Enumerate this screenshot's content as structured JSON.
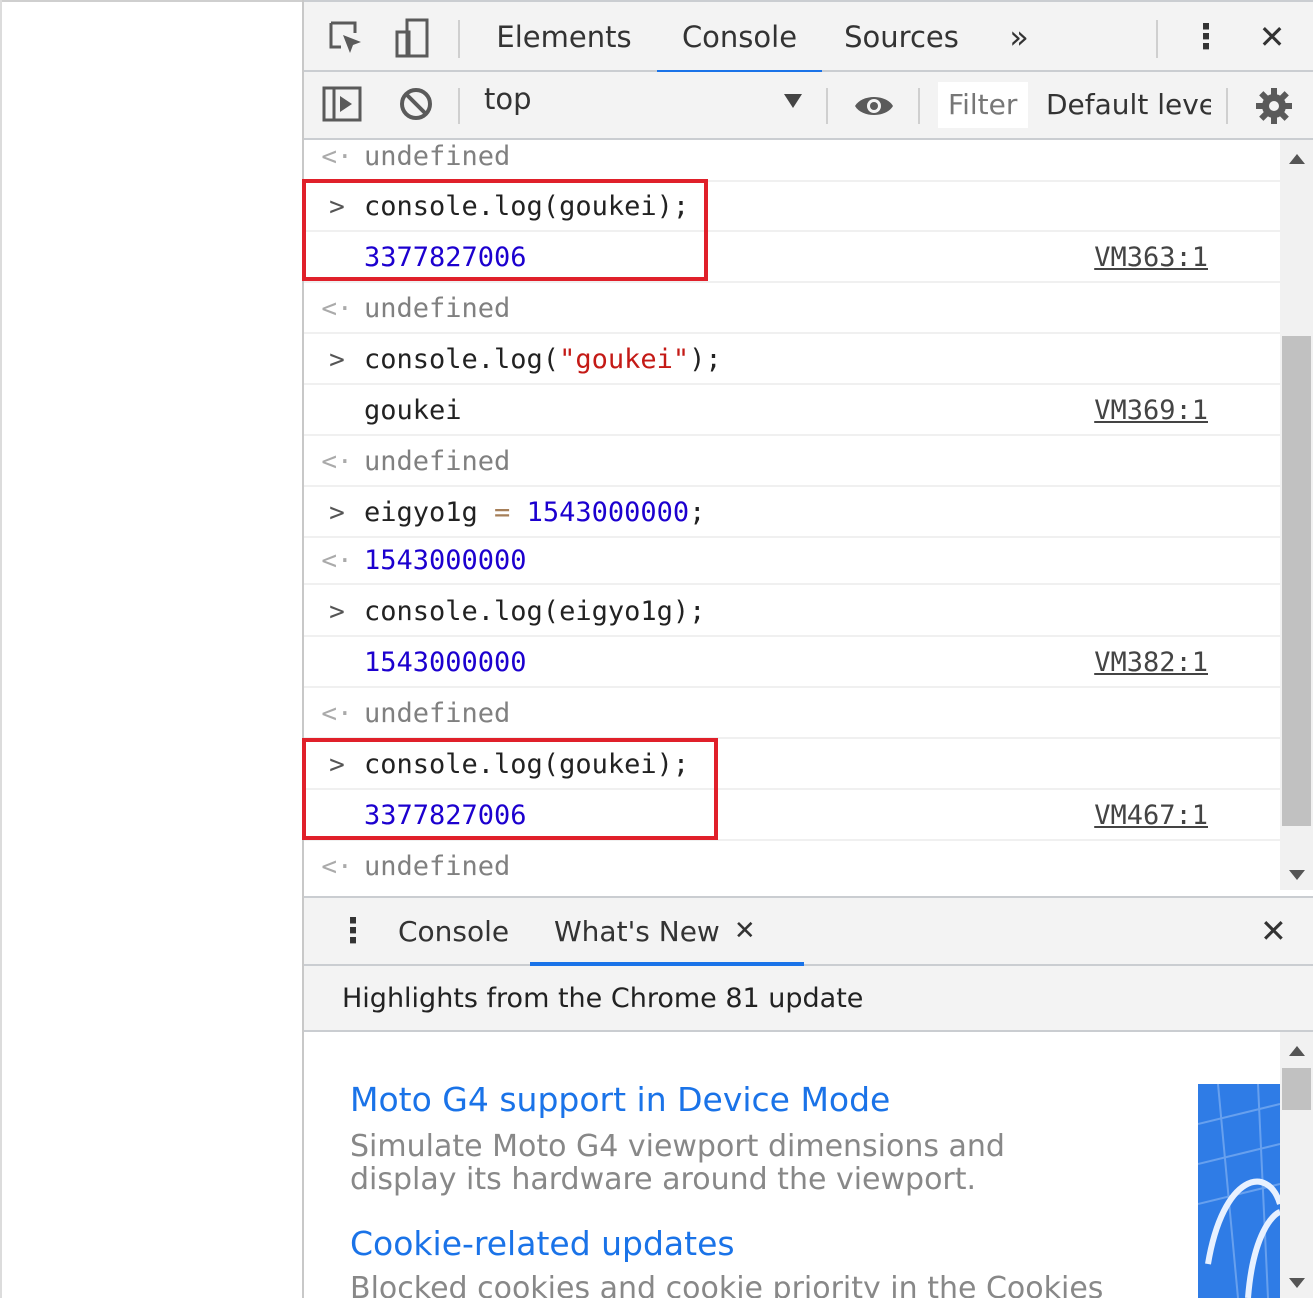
{
  "devtools": {
    "tabs": [
      "Elements",
      "Console",
      "Sources"
    ],
    "active_tab": "Console",
    "more_tabs_glyph": "»",
    "menu_glyph": "⋮",
    "close_glyph": "✕"
  },
  "console_toolbar": {
    "context": "top",
    "filter_placeholder": "Filter",
    "levels_label": "Default levels"
  },
  "console": {
    "lines": [
      {
        "kind": "result",
        "text": "undefined"
      },
      {
        "kind": "input",
        "text": "console.log(goukei);"
      },
      {
        "kind": "log",
        "text": "3377827006",
        "source": "VM363:1"
      },
      {
        "kind": "result",
        "text": "undefined"
      },
      {
        "kind": "input",
        "text_pre": "console.log(",
        "text_str": "\"goukei\"",
        "text_post": ");"
      },
      {
        "kind": "log",
        "text": "goukei",
        "source": "VM369:1"
      },
      {
        "kind": "result",
        "text": "undefined"
      },
      {
        "kind": "input",
        "text_pre": "eigyo1g ",
        "text_op": "=",
        "text_num": "1543000000",
        "text_post": ";"
      },
      {
        "kind": "result",
        "text": "1543000000"
      },
      {
        "kind": "input",
        "text": "console.log(eigyo1g);"
      },
      {
        "kind": "log",
        "text": "1543000000",
        "source": "VM382:1"
      },
      {
        "kind": "result",
        "text": "undefined"
      },
      {
        "kind": "input",
        "text": "console.log(goukei);"
      },
      {
        "kind": "log",
        "text": "3377827006",
        "source": "VM467:1"
      },
      {
        "kind": "result",
        "text": "undefined"
      }
    ]
  },
  "drawer": {
    "tabs": [
      "Console",
      "What's New"
    ],
    "active_tab": "What's New",
    "header": "Highlights from the Chrome 81 update",
    "items": [
      {
        "title": "Moto G4 support in Device Mode",
        "desc_line1": "Simulate Moto G4 viewport dimensions and",
        "desc_line2": "display its hardware around the viewport."
      },
      {
        "title": "Cookie-related updates",
        "desc_line1": "Blocked cookies and cookie priority in the Cookies"
      }
    ]
  },
  "colors": {
    "accent": "#1a73e8",
    "highlight": "#e0202a",
    "number": "#1c00cf",
    "string": "#c41a16"
  }
}
